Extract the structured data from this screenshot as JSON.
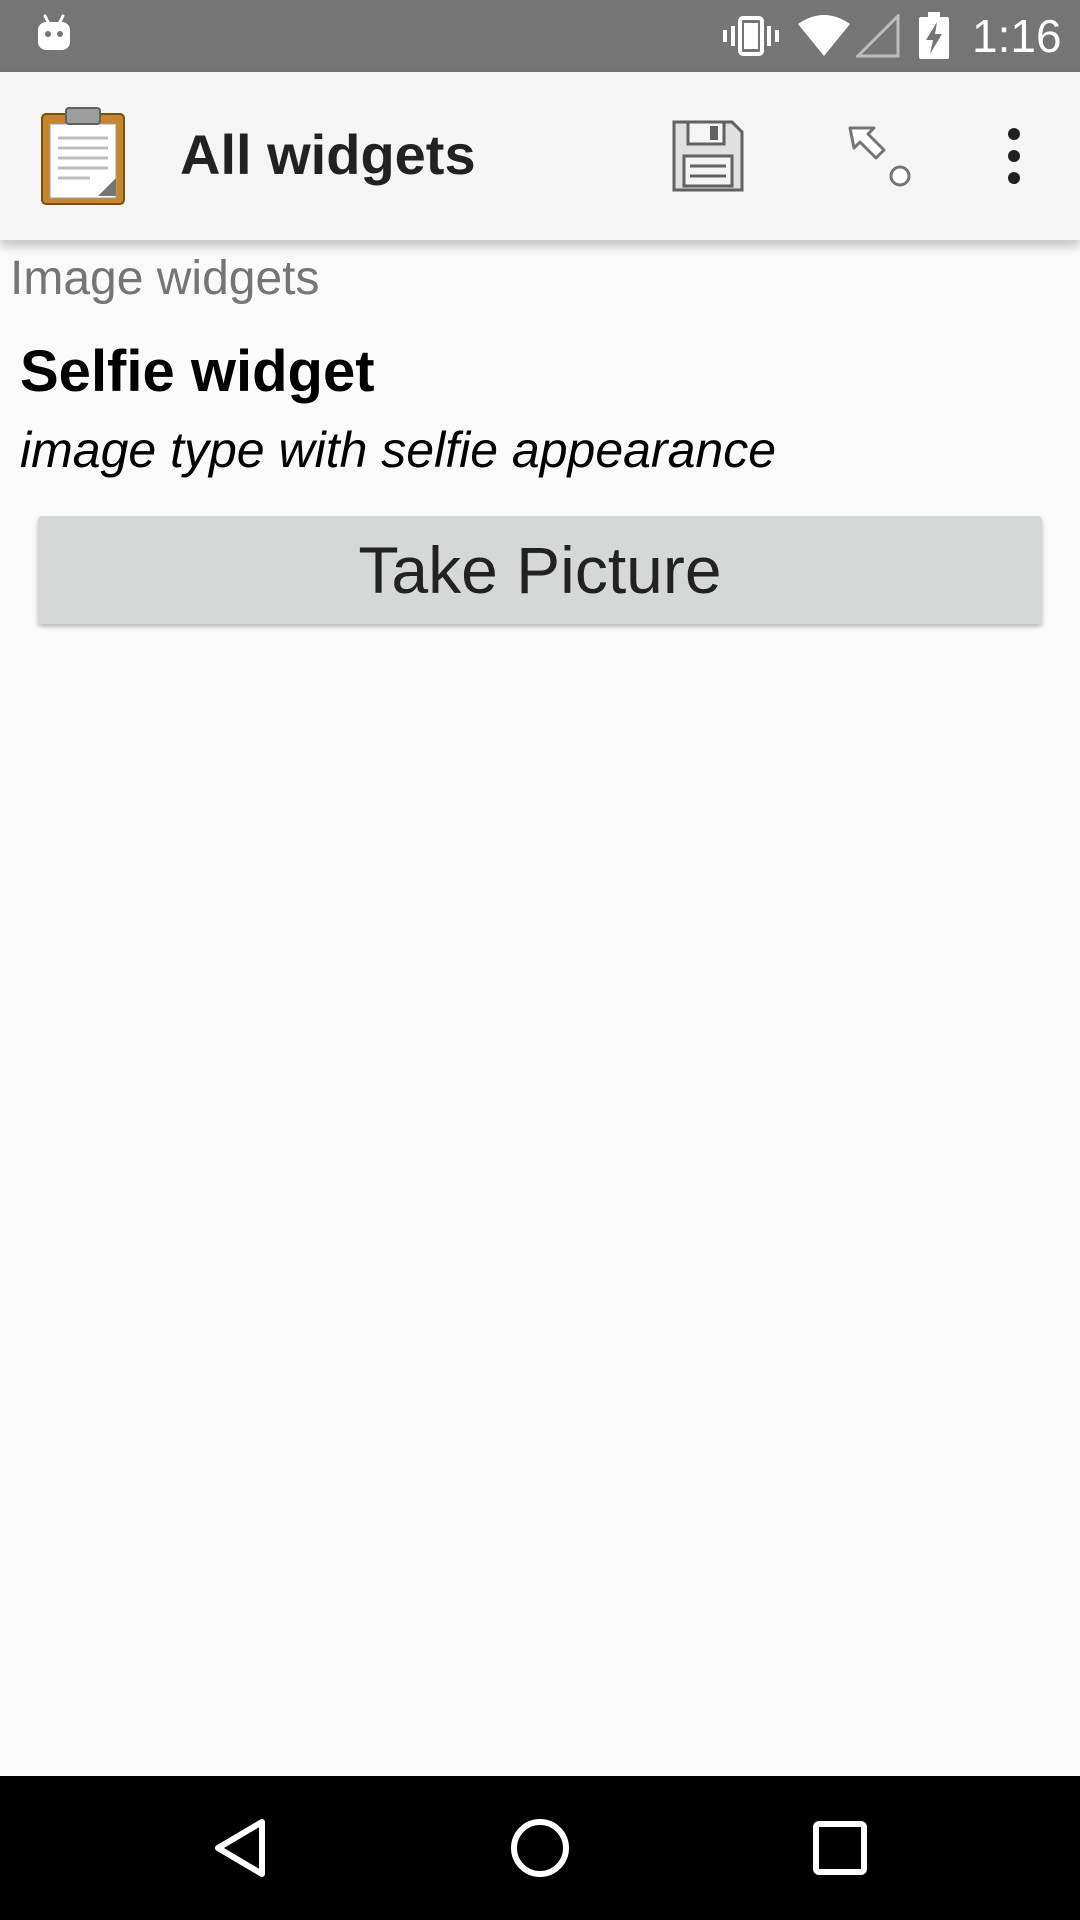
{
  "status_bar": {
    "time": "1:16",
    "icons": [
      "android-icon",
      "vibrate-icon",
      "wifi-icon",
      "signal-icon",
      "battery-charging-icon"
    ]
  },
  "app_bar": {
    "title": "All widgets",
    "logo_icon": "clipboard-icon",
    "actions": [
      {
        "name": "save",
        "icon": "floppy-disk-icon"
      },
      {
        "name": "go-to",
        "icon": "jump-arrow-icon"
      },
      {
        "name": "more-options",
        "icon": "vertical-dots-icon"
      }
    ]
  },
  "form": {
    "group_label": "Image widgets",
    "question_label": "Selfie widget",
    "question_hint": "image type with selfie appearance",
    "take_picture_label": "Take Picture"
  },
  "nav_bar": {
    "buttons": [
      "back-icon",
      "home-icon",
      "recents-icon"
    ]
  },
  "colors": {
    "status_bar_bg": "#757575",
    "app_bar_bg": "#f5f5f5",
    "content_bg": "#fafafa",
    "button_bg": "#d6d7d7",
    "nav_bar_bg": "#000000",
    "group_label_color": "#757575"
  }
}
